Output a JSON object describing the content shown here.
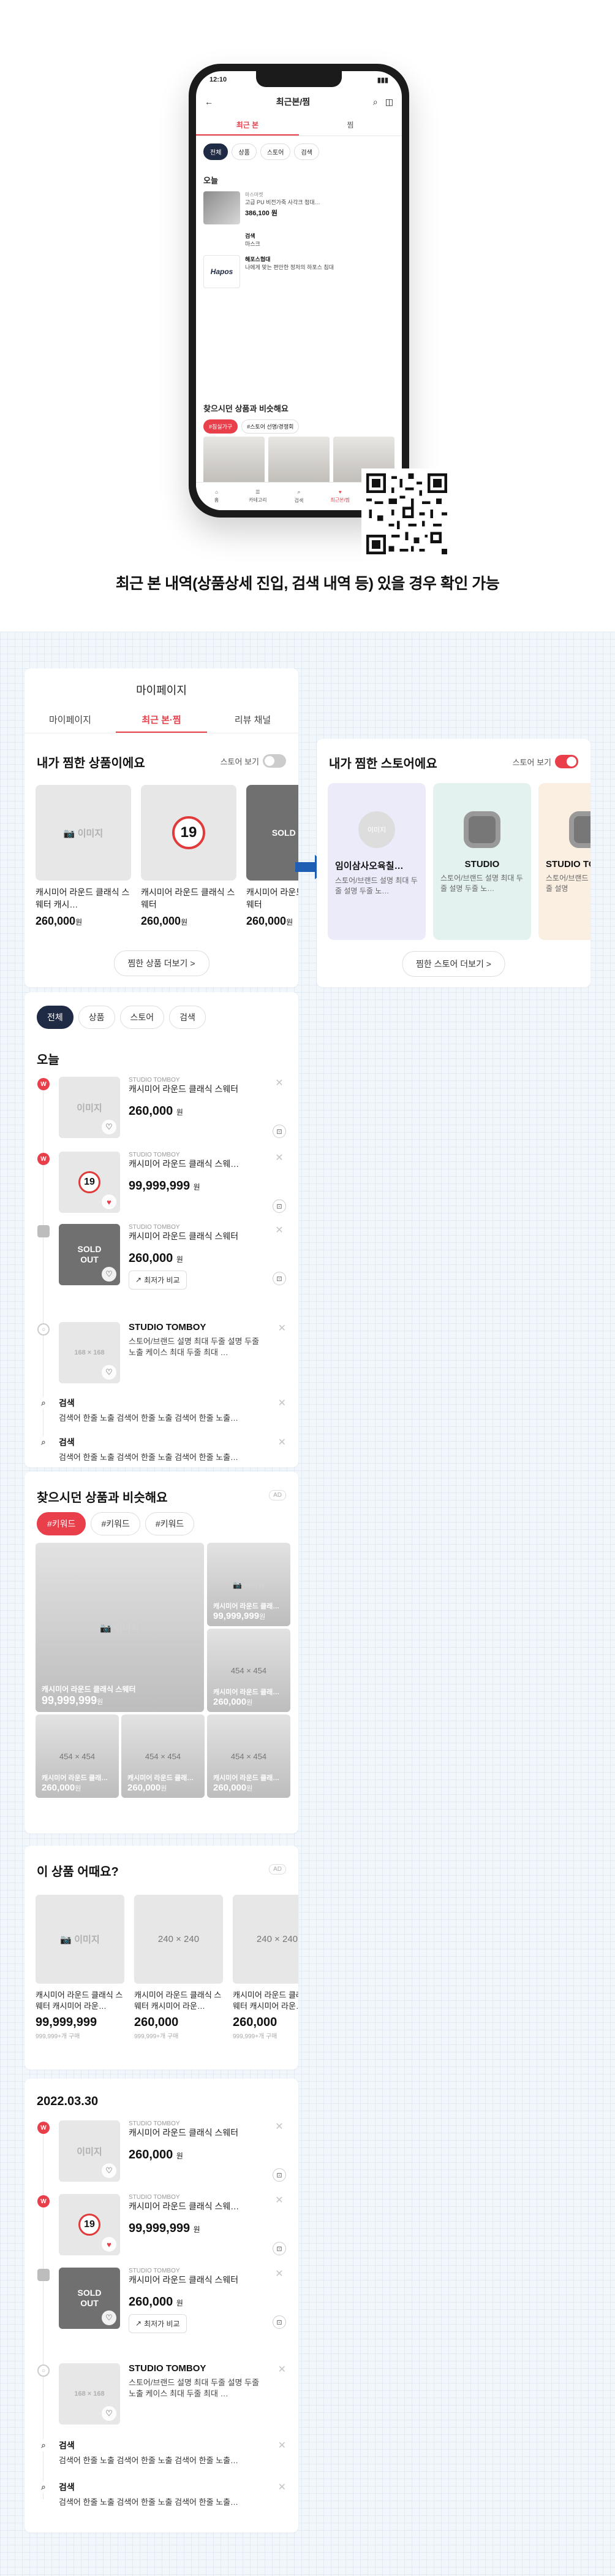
{
  "colors": {
    "accent": "#e93f4b",
    "navy": "#1f2a44",
    "arrow": "#1e5fb4"
  },
  "caption": "최근 본 내역(상품상세 진입, 검색 내역 등) 있을 경우 확인 가능",
  "phone": {
    "time": "12:10",
    "title": "최근본/찜",
    "tabs": [
      "최근 본",
      "찜"
    ],
    "chips": [
      "전체",
      "상품",
      "스토어",
      "검색"
    ],
    "today": "오늘",
    "item1": {
      "brand": "마스마켓",
      "name": "고급 PU 비전가죽 사각크 첨대…",
      "price": "386,100 원"
    },
    "item2": {
      "title": "검색",
      "sub": "마스크"
    },
    "item3": {
      "logo": "Hapos",
      "title": "해포스협대",
      "desc": "나에게 맞는 편안한 정저의 하포스 침대"
    },
    "similar_title": "찾으시던 상품과 비슷해요",
    "tags": [
      "#침실가구",
      "#스토어 선명/경쟁회"
    ],
    "nav": [
      "홈",
      "카테고리",
      "검색",
      "최근본/찜",
      "MY"
    ]
  },
  "mypage": {
    "title": "마이페이지",
    "tabs": [
      "마이페이지",
      "최근 본·찜",
      "리뷰 채널"
    ],
    "wish_products": {
      "title": "내가 찜한 상품이에요",
      "toggle_label": "스토어 보기",
      "items": [
        {
          "thumb": "📷 이미지",
          "name": "캐시미어 라운드 클래식 스웨터 캐시…",
          "price": "260,000",
          "unit": "원"
        },
        {
          "thumb": "19",
          "name": "캐시미어 라운드 클래식 스웨터",
          "price": "260,000",
          "unit": "원"
        },
        {
          "thumb": "SOLD OUT",
          "name": "캐시미어 라운드 클래식 스웨터",
          "price": "260,000",
          "unit": "원"
        }
      ],
      "more": "찜한 상품 더보기 >"
    },
    "wish_stores": {
      "title": "내가 찜한 스토어에요",
      "toggle_label": "스토어 보기",
      "items": [
        {
          "name": "임이삼사오육칠…",
          "desc": "스토어/브랜드 설명 최대 두줄 설명 두줄 노…"
        },
        {
          "name": "STUDIO",
          "desc": "스토어/브랜드 설명 최대 두줄 설명 두줄 노…"
        },
        {
          "name": "STUDIO TO",
          "desc": "스토어/브랜드 설명 최대 두줄 설명"
        }
      ],
      "more": "찜한 스토어 더보기 >"
    },
    "recent": {
      "chips": [
        "전체",
        "상품",
        "스토어",
        "검색"
      ],
      "day": "오늘",
      "rows": [
        {
          "brand": "STUDIO TOMBOY",
          "name": "캐시미어 라운드 클래식 스웨터",
          "price": "260,000",
          "unit": "원"
        },
        {
          "brand": "STUDIO TOMBOY",
          "name": "캐시미어 라운드 클래식 스웨…",
          "price": "99,999,999",
          "unit": "원"
        },
        {
          "brand": "STUDIO TOMBOY",
          "name": "캐시미어 라운드 클래식 스웨터",
          "price": "260,000",
          "unit": "원",
          "compare": "최저가 비교"
        }
      ],
      "store": {
        "thumb": "168 × 168",
        "name": "STUDIO TOMBOY",
        "desc": "스토어/브랜드 설명 최대 두줄 설명 두줄 노출 케이스 최대 두줄 최대 …"
      },
      "searches": [
        {
          "title": "검색",
          "text": "검색어 한줄 노출 검색어 한줄 노출 검색어 한줄 노출…"
        },
        {
          "title": "검색",
          "text": "검색어 한줄 노출 검색어 한줄 노출 검색어 한줄 노출…"
        }
      ]
    },
    "similar": {
      "title": "찾으시던 상품과 비슷해요",
      "ad": "AD",
      "tags": [
        "#키워드",
        "#키워드",
        "#키워드"
      ],
      "big": {
        "thumb": "📷 이미지",
        "name": "캐시미어 라운드 클래식 스웨터",
        "price": "99,999,999",
        "unit": "원"
      },
      "tiles": [
        {
          "thumb": "📷 이미지",
          "name": "캐시미어 라운드 클래…",
          "price": "99,999,999",
          "unit": "원"
        },
        {
          "thumb": "454 × 454",
          "name": "캐시미어 라운드 클래…",
          "price": "260,000",
          "unit": "원"
        },
        {
          "thumb": "454 × 454",
          "name": "캐시미어 라운드 클래…",
          "price": "260,000",
          "unit": "원"
        },
        {
          "thumb": "454 × 454",
          "name": "캐시미어 라운드 클래…",
          "price": "260,000",
          "unit": "원"
        },
        {
          "thumb": "454 × 454",
          "name": "캐시미어 라운드 클래…",
          "price": "260,000",
          "unit": "원"
        }
      ]
    },
    "suggest": {
      "title": "이 상품 어때요?",
      "ad": "AD",
      "items": [
        {
          "thumb": "📷 이미지",
          "name": "캐시미어 라운드 클래식 스웨터 캐시미어 라운…",
          "price": "99,999,999",
          "meta": "999,999+개 구매"
        },
        {
          "thumb": "240 × 240",
          "name": "캐시미어 라운드 클래식 스웨터 캐시미어 라운…",
          "price": "260,000",
          "meta": "999,999+개 구매"
        },
        {
          "thumb": "240 × 240",
          "name": "캐시미어 라운드 클래식 스웨터 캐시미어 라운…",
          "price": "260,000",
          "meta": "999,999+개 구매"
        }
      ]
    },
    "history": {
      "date": "2022.03.30",
      "rows": [
        {
          "brand": "STUDIO TOMBOY",
          "name": "캐시미어 라운드 클래식 스웨터",
          "price": "260,000",
          "unit": "원"
        },
        {
          "brand": "STUDIO TOMBOY",
          "name": "캐시미어 라운드 클래식 스웨…",
          "price": "99,999,999",
          "unit": "원"
        },
        {
          "brand": "STUDIO TOMBOY",
          "name": "캐시미어 라운드 클래식 스웨터",
          "price": "260,000",
          "unit": "원",
          "compare": "최저가 비교"
        }
      ],
      "store": {
        "thumb": "168 × 168",
        "name": "STUDIO TOMBOY",
        "desc": "스토어/브랜드 설명 최대 두줄 설명 두줄 노출 케이스 최대 두줄 최대 …"
      },
      "searches": [
        {
          "title": "검색",
          "text": "검색어 한줄 노출 검색어 한줄 노출 검색어 한줄 노출…"
        },
        {
          "title": "검색",
          "text": "검색어 한줄 노출 검색어 한줄 노출 검색어 한줄 노출…"
        }
      ]
    }
  },
  "icons": [
    "back-arrow-icon",
    "search-icon",
    "bag-icon",
    "heart-icon",
    "close-icon",
    "home-icon",
    "menu-icon",
    "compare-link-icon",
    "chevron-right-icon",
    "arrow-right-icon"
  ]
}
